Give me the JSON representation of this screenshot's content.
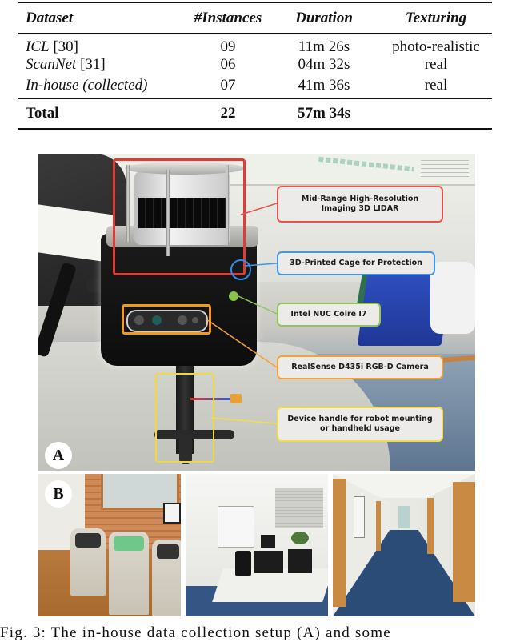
{
  "table": {
    "headers": [
      "Dataset",
      "#Instances",
      "Duration",
      "Texturing"
    ],
    "rows": [
      {
        "dataset": "ICL",
        "ref": "[30]",
        "instances": "09",
        "duration": "11m 26s",
        "texturing": "photo-realistic"
      },
      {
        "dataset": "ScanNet",
        "ref": "[31]",
        "instances": "06",
        "duration": "04m 32s",
        "texturing": "real"
      },
      {
        "dataset": "In-house (collected)",
        "ref": "",
        "instances": "07",
        "duration": "41m 36s",
        "texturing": "real"
      }
    ],
    "total": {
      "label": "Total",
      "instances": "22",
      "duration": "57m 34s",
      "texturing": ""
    }
  },
  "figure": {
    "panel_a": {
      "badge": "A",
      "callouts": [
        {
          "text": "Mid-Range High-Resolution Imaging 3D LIDAR",
          "color": "#e5534b"
        },
        {
          "text": "3D-Printed Cage for Protection",
          "color": "#3f98e6"
        },
        {
          "text": "Intel NUC Colre I7",
          "color": "#93c35a"
        },
        {
          "text": "RealSense D435i RGB-D Camera",
          "color": "#f3a23a"
        },
        {
          "text": "Device handle for robot mounting or handheld usage",
          "color": "#f3dc4a"
        }
      ]
    },
    "panel_b": {
      "badge": "B",
      "images": [
        "recycling-bins-scene",
        "office-scene",
        "corridor-scene"
      ]
    }
  },
  "caption": "Fig. 3: The in-house data collection setup (A) and some"
}
